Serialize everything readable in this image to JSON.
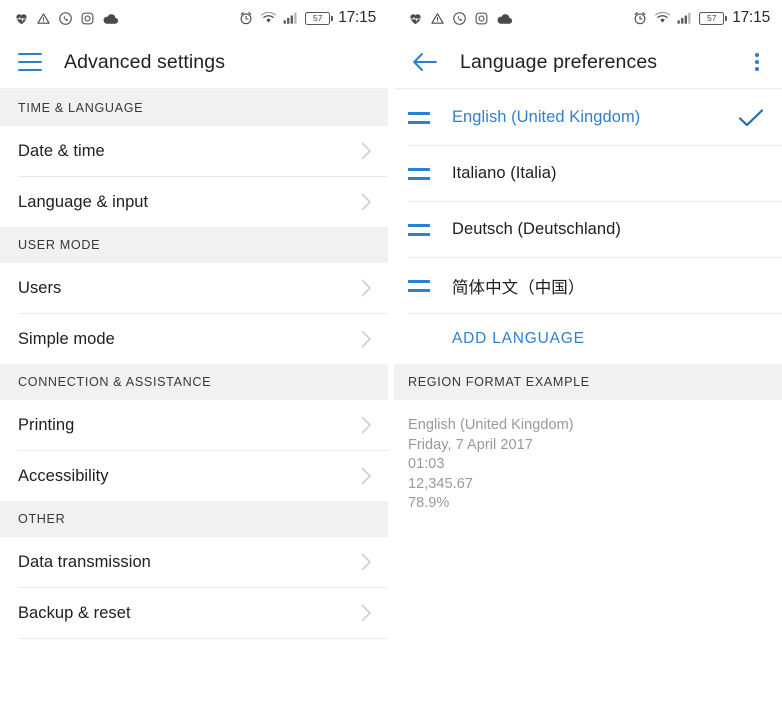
{
  "status_bar": {
    "left_icons": [
      "heart-rate-icon",
      "warning-triangle-icon",
      "whatsapp-icon",
      "instagram-icon",
      "cloud-icon"
    ],
    "right_icons": [
      "alarm-clock-icon",
      "wifi-icon",
      "signal-bars-icon",
      "battery-icon"
    ],
    "battery_level": "57",
    "time": "17:15"
  },
  "colors": {
    "accent_blue": "#2f7fd0",
    "check_blue": "#1d69b5",
    "section_header_bg": "#f1f1f1",
    "divider": "#ebebeb",
    "primary_text": "#202020",
    "muted_text": "#9a9a9a"
  },
  "left_screen": {
    "appbar": {
      "menu_icon": "hamburger-menu-icon",
      "title": "Advanced settings"
    },
    "sections": [
      {
        "header": "TIME & LANGUAGE",
        "items": [
          {
            "label": "Date & time"
          },
          {
            "label": "Language & input"
          }
        ]
      },
      {
        "header": "USER MODE",
        "items": [
          {
            "label": "Users"
          },
          {
            "label": "Simple mode"
          }
        ]
      },
      {
        "header": "CONNECTION & ASSISTANCE",
        "items": [
          {
            "label": "Printing"
          },
          {
            "label": "Accessibility"
          }
        ]
      },
      {
        "header": "OTHER",
        "items": [
          {
            "label": "Data transmission"
          },
          {
            "label": "Backup & reset"
          }
        ]
      }
    ]
  },
  "right_screen": {
    "appbar": {
      "back_icon": "back-arrow-icon",
      "title": "Language preferences",
      "overflow_icon": "overflow-menu-icon"
    },
    "languages": [
      {
        "label": "English (United Kingdom)",
        "selected": true
      },
      {
        "label": "Italiano (Italia)",
        "selected": false
      },
      {
        "label": "Deutsch (Deutschland)",
        "selected": false
      },
      {
        "label": "简体中文（中国）",
        "selected": false
      }
    ],
    "add_language_label": "ADD LANGUAGE",
    "region_section": {
      "header": "REGION FORMAT EXAMPLE",
      "lines": [
        "English (United Kingdom)",
        "Friday, 7 April 2017",
        "01:03",
        "12,345.67",
        "78.9%"
      ]
    }
  }
}
